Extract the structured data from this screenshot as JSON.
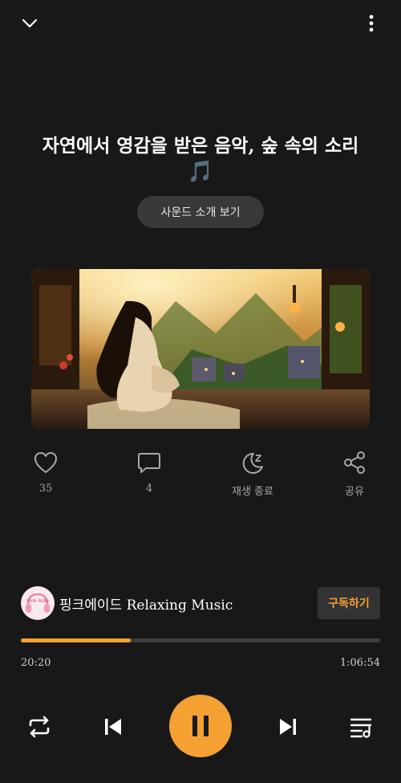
{
  "header": {
    "collapse_icon": "chevron-down-icon",
    "more_icon": "more-vertical-icon"
  },
  "title": "자연에서 영감을 받은 음악, 숲 속의 소리",
  "title_emoji": "🎵",
  "intro_button": "사운드 소개 보기",
  "actions": {
    "like": {
      "icon": "heart-icon",
      "label": "35"
    },
    "comment": {
      "icon": "comment-icon",
      "label": "4"
    },
    "sleep_timer": {
      "icon": "moon-sleep-icon",
      "label": "재생 종료"
    },
    "share": {
      "icon": "share-icon",
      "label": "공유"
    }
  },
  "channel": {
    "avatar_text": "Pink Aide",
    "name": "핑크에이드 Relaxing Music",
    "subscribe_label": "구독하기"
  },
  "progress": {
    "elapsed": "20:20",
    "duration": "1:06:54",
    "fraction": 0.305
  },
  "controls": {
    "repeat": "repeat-icon",
    "previous": "skip-previous-icon",
    "play_pause": "pause-icon",
    "next": "skip-next-icon",
    "playlist": "playlist-icon"
  },
  "colors": {
    "accent": "#f5a033",
    "background": "#181818"
  }
}
